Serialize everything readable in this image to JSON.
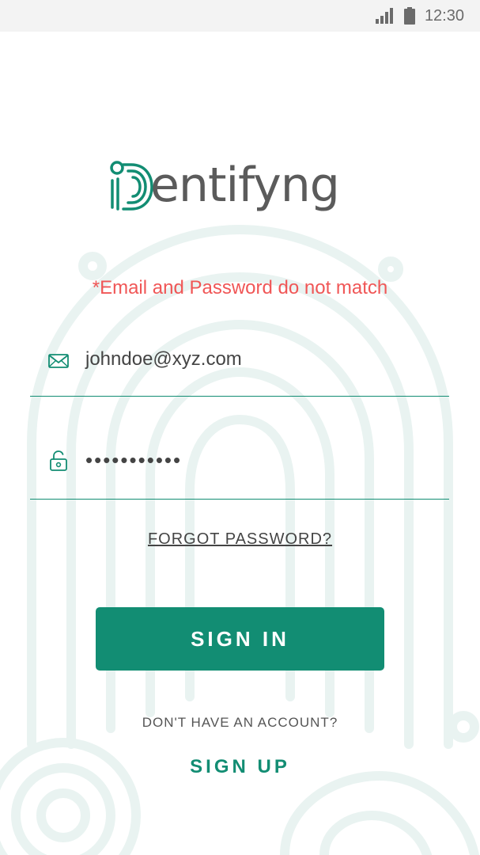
{
  "status_bar": {
    "time": "12:30",
    "icons": [
      "signal-icon",
      "battery-icon"
    ]
  },
  "brand": {
    "name": "iDentifyng",
    "wordmark_rest": "entifyng",
    "colors": {
      "accent": "#128d73",
      "text": "#5b5b5b",
      "error": "#f05656"
    }
  },
  "form": {
    "error_message": "*Email and Password do not match",
    "email": {
      "icon": "mail-icon",
      "value": "johndoe@xyz.com"
    },
    "password": {
      "icon": "unlock-icon",
      "value": "•••••••••••"
    },
    "forgot_label": "FORGOT PASSWORD?",
    "signin_label": "SIGN IN"
  },
  "footer": {
    "prompt": "DON'T HAVE AN ACCOUNT?",
    "signup_label": "SIGN UP"
  }
}
